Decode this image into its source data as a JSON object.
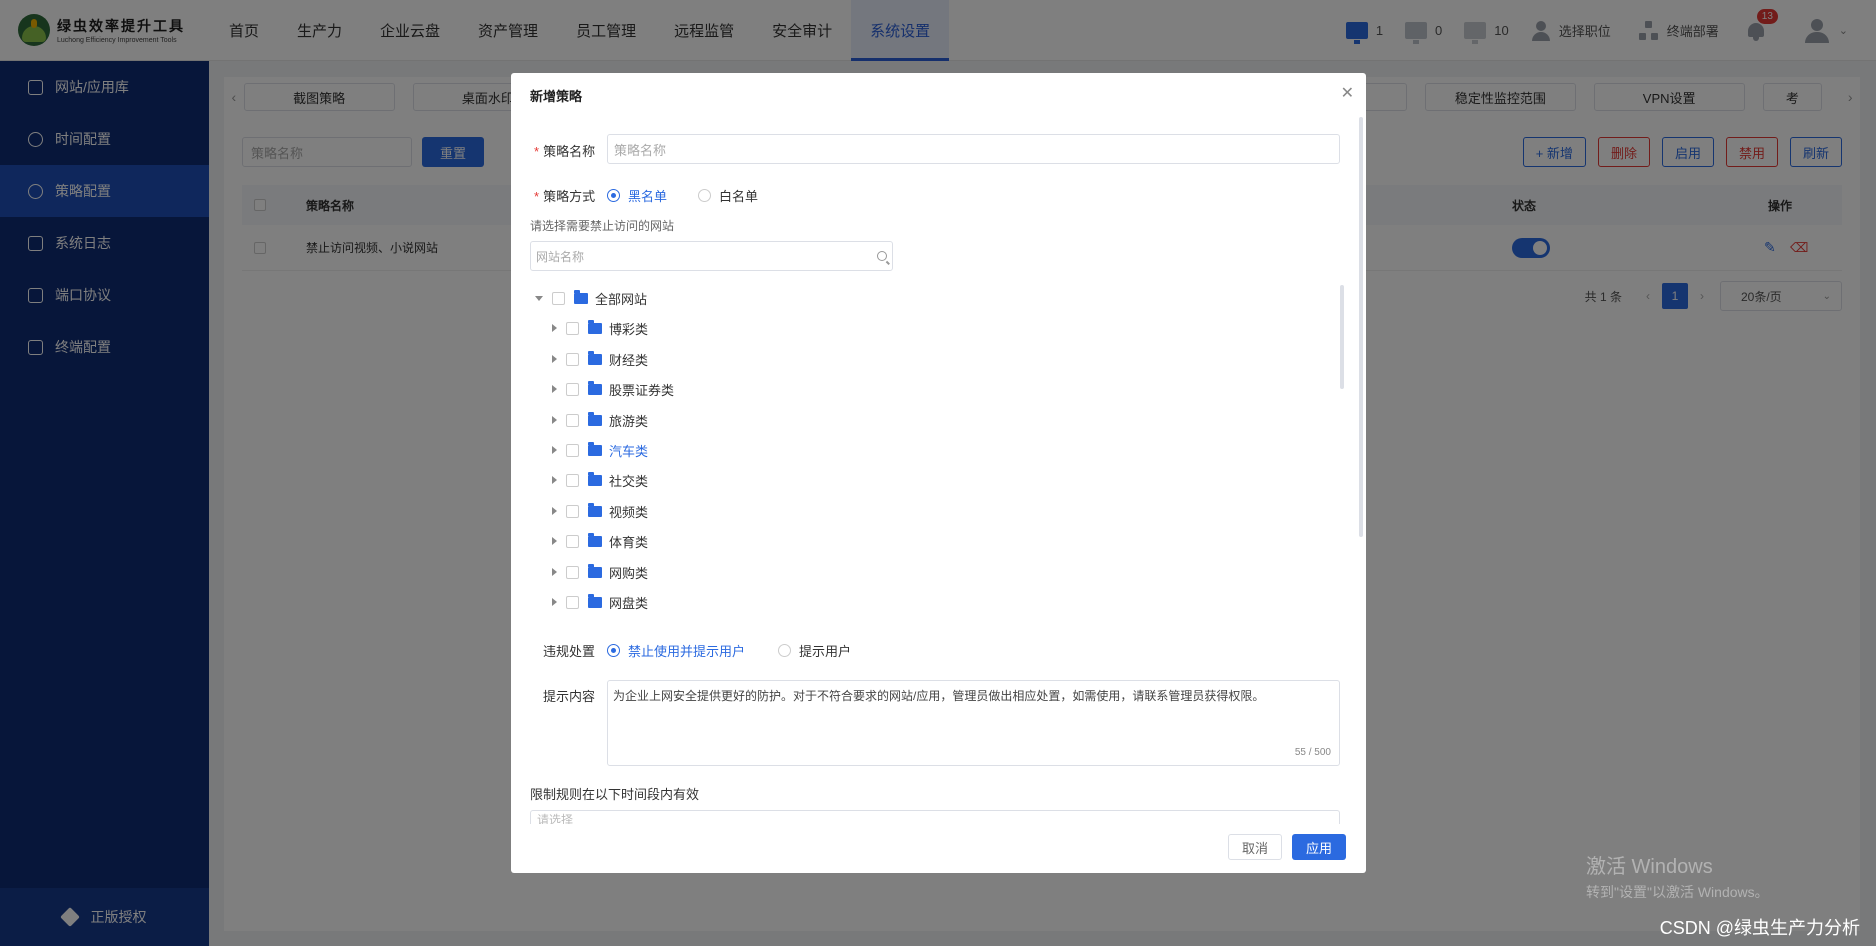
{
  "app": {
    "logo_cn": "绿虫效率提升工具",
    "logo_en": "Luchong Efficiency Improvement Tools"
  },
  "nav": {
    "items": [
      "首页",
      "生产力",
      "企业云盘",
      "资产管理",
      "员工管理",
      "远程监管",
      "安全审计",
      "系统设置"
    ],
    "active": "系统设置"
  },
  "topbar": {
    "online_count": "1",
    "idle_count": "0",
    "offline_count": "10",
    "select_position": "选择职位",
    "deploy_terminal": "终端部署",
    "notification_count": "13",
    "dropdown_icon": "chevron-down-icon"
  },
  "sidebar": {
    "items": [
      {
        "label": "网站/应用库",
        "icon": "app-library-icon"
      },
      {
        "label": "时间配置",
        "icon": "clock-icon"
      },
      {
        "label": "策略配置",
        "icon": "policy-icon"
      },
      {
        "label": "系统日志",
        "icon": "log-icon"
      },
      {
        "label": "端口协议",
        "icon": "port-icon"
      },
      {
        "label": "终端配置",
        "icon": "terminal-config-icon"
      }
    ],
    "active_index": 2,
    "license": "正版授权"
  },
  "background": {
    "tabs": [
      "截图策略",
      "桌面水印",
      "",
      "",
      "",
      "",
      "",
      "稳定性监控范围",
      "VPN设置",
      "考"
    ],
    "filter_placeholder": "策略名称",
    "reset_button": "重置",
    "actions": [
      "+ 新增",
      "删除",
      "启用",
      "禁用",
      "刷新"
    ],
    "table_headers": {
      "name": "策略名称",
      "status": "状态",
      "ops": "操作"
    },
    "rows": [
      {
        "name": "禁止访问视频、小说网站",
        "enabled": true
      }
    ],
    "pager": {
      "total": "共 1 条",
      "page": "1",
      "page_size": "20条/页"
    }
  },
  "modal": {
    "title": "新增策略",
    "close_icon": "close-icon",
    "name_label": "策略名称",
    "name_placeholder": "策略名称",
    "mode_label": "策略方式",
    "mode_options": [
      "黑名单",
      "白名单"
    ],
    "mode_selected": "黑名单",
    "site_hint": "请选择需要禁止访问的网站",
    "site_search_placeholder": "网站名称",
    "tree": {
      "root": "全部网站",
      "children": [
        "博彩类",
        "财经类",
        "股票证券类",
        "旅游类",
        "汽车类",
        "社交类",
        "视频类",
        "体育类",
        "网购类",
        "网盘类"
      ],
      "highlighted": "汽车类"
    },
    "violation_label": "违规处置",
    "violation_options": [
      "禁止使用并提示用户",
      "提示用户"
    ],
    "violation_selected": "禁止使用并提示用户",
    "prompt_label": "提示内容",
    "prompt_text": "为企业上网安全提供更好的防护。对于不符合要求的网站/应用，管理员做出相应处置，如需使用，请联系管理员获得权限。",
    "prompt_counter": "55 / 500",
    "time_section": "限制规则在以下时间段内有效",
    "time_placeholder": "请选择",
    "cancel_button": "取消",
    "apply_button": "应用"
  },
  "watermark": {
    "line1": "激活 Windows",
    "line2": "转到\"设置\"以激活 Windows。",
    "csdn": "CSDN @绿虫生产力分析"
  },
  "colors": {
    "primary": "#2b6ae0",
    "sidebar": "#0f2c74",
    "danger": "#e53935"
  }
}
